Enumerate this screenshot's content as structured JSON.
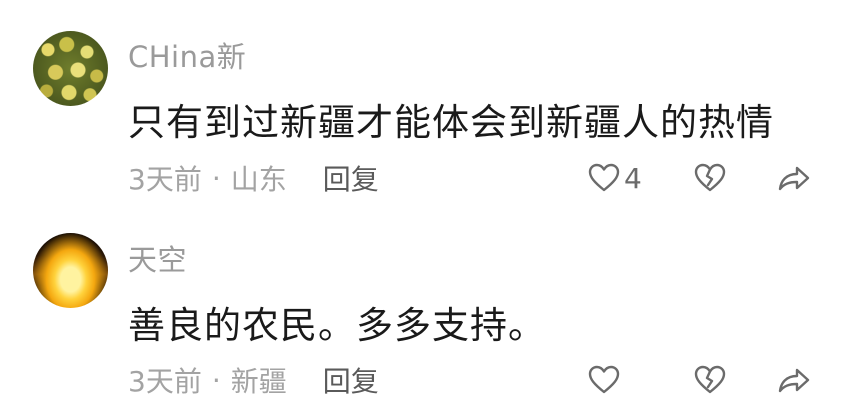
{
  "comments": [
    {
      "username": "CHina新",
      "avatar_icon": "fruit-avatar",
      "content": "只有到过新疆才能体会到新疆人的热情",
      "time": "3天前",
      "separator": "·",
      "location": "山东",
      "reply_label": "回复",
      "like_count": "4"
    },
    {
      "username": "天空",
      "avatar_icon": "sunset-avatar",
      "content": "善良的农民。多多支持。",
      "time": "3天前",
      "separator": "·",
      "location": "新疆",
      "reply_label": "回复",
      "like_count": ""
    }
  ],
  "icons": {
    "like": "heart-icon",
    "dislike": "broken-heart-icon",
    "share": "share-icon"
  },
  "colors": {
    "username": "#9a9a9a",
    "meta": "#a3a3a3",
    "reply": "#5a5a5a",
    "icon": "#6b6b6b"
  }
}
